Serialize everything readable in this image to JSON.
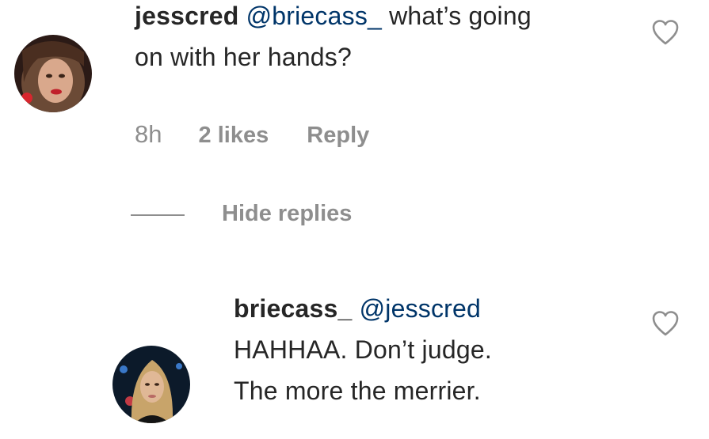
{
  "comments": [
    {
      "username": "jesscred",
      "mention": "@briecass_",
      "text_line1": "what’s going",
      "text_line2": "on with her hands?",
      "time": "8h",
      "likes": "2 likes",
      "reply_label": "Reply",
      "icon": "heart-outline-icon"
    }
  ],
  "thread": {
    "hide_replies_label": "Hide replies"
  },
  "replies": [
    {
      "username": "briecass_",
      "mention": "@jesscred",
      "text_line1": "HAHHAA. Don’t judge.",
      "text_line2": "The more the merrier.",
      "icon": "heart-outline-icon"
    }
  ],
  "colors": {
    "text": "#262626",
    "mention": "#003569",
    "secondary": "#8e8e8e"
  }
}
